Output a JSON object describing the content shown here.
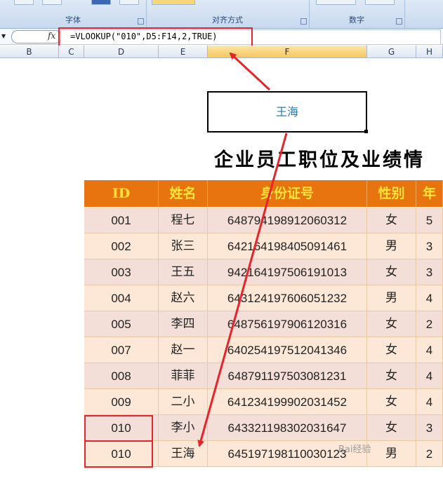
{
  "ribbon": {
    "groups": [
      {
        "label": "字体"
      },
      {
        "label": "对齐方式"
      },
      {
        "label": "数字"
      }
    ]
  },
  "formula_bar": {
    "fx_label": "fx",
    "formula": "=VLOOKUP(\"010\",D5:F14,2,TRUE)"
  },
  "column_headers": [
    "B",
    "C",
    "D",
    "E",
    "F",
    "G",
    "H"
  ],
  "result_cell": {
    "value": "王海"
  },
  "sheet_title": "企业员工职位及业绩情",
  "table": {
    "headers": [
      "ID",
      "姓名",
      "身份证号",
      "性别",
      "年"
    ],
    "rows": [
      [
        "001",
        "程七",
        "648794198912060312",
        "女",
        "5"
      ],
      [
        "002",
        "张三",
        "642164198405091461",
        "男",
        "3"
      ],
      [
        "003",
        "王五",
        "942164197506191013",
        "女",
        "3"
      ],
      [
        "004",
        "赵六",
        "643124197606051232",
        "男",
        "4"
      ],
      [
        "005",
        "李四",
        "648756197906120316",
        "女",
        "2"
      ],
      [
        "007",
        "赵一",
        "640254197512041346",
        "女",
        "4"
      ],
      [
        "008",
        "菲菲",
        "648791197503081231",
        "女",
        "4"
      ],
      [
        "009",
        "二小",
        "641234199902031452",
        "女",
        "4"
      ],
      [
        "010",
        "李小",
        "643321198302031647",
        "女",
        "3"
      ],
      [
        "010",
        "王海",
        "645197198110030123",
        "男",
        "2"
      ]
    ]
  },
  "colors": {
    "header_bg": "#e8740f",
    "header_text": "#ffe43a",
    "highlight": "#e8232a",
    "result_text": "#1f7bbd"
  },
  "watermark": "Bai经验"
}
